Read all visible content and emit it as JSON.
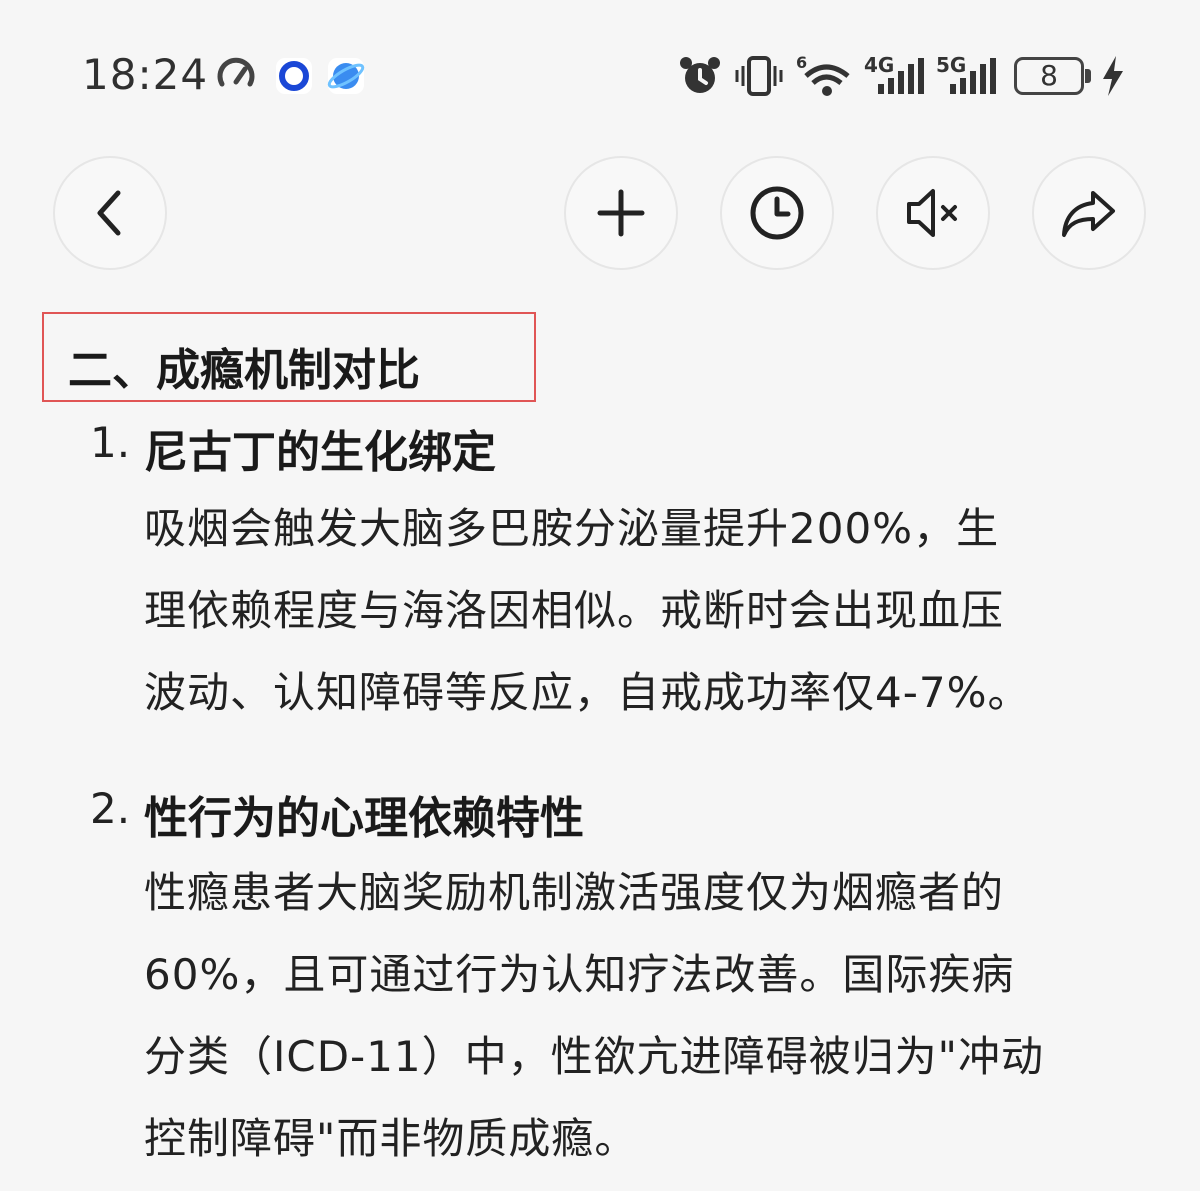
{
  "status_bar": {
    "time": "18:24",
    "battery": "8",
    "wifi_badge": "6",
    "network_1": "4G",
    "network_2": "5G",
    "icons": [
      "speedometer-icon",
      "blue-ring-app-icon",
      "browser-app-icon",
      "alarm-icon",
      "vibrate-icon",
      "wifi-icon",
      "signal-4g-icon",
      "signal-5g-icon",
      "battery-icon",
      "charging-icon"
    ]
  },
  "toolbar": {
    "back": "back-icon",
    "new": "plus-icon",
    "history": "clock-icon",
    "mute": "speaker-mute-icon",
    "share": "share-icon"
  },
  "article": {
    "section_title": "二、成瘾机制对比",
    "items": [
      {
        "number": "1.",
        "heading": "尼古丁的生化绑定",
        "lines": [
          "吸烟会触发大脑多巴胺分泌量提升200%，生",
          "理依赖程度与海洛因相似。戒断时会出现血压",
          "波动、认知障碍等反应，自戒成功率仅4-7%。"
        ]
      },
      {
        "number": "2.",
        "heading": "性行为的心理依赖特性",
        "lines": [
          "性瘾患者大脑奖励机制激活强度仅为烟瘾者的",
          "60%，且可通过行为认知疗法改善。国际疾病",
          "分类（ICD-11）中，性欲亢进障碍被归为\"冲动",
          "控制障碍\"而非物质成瘾。"
        ]
      }
    ]
  },
  "colors": {
    "highlight_border": "#e05555",
    "background": "#f6f6f6"
  }
}
